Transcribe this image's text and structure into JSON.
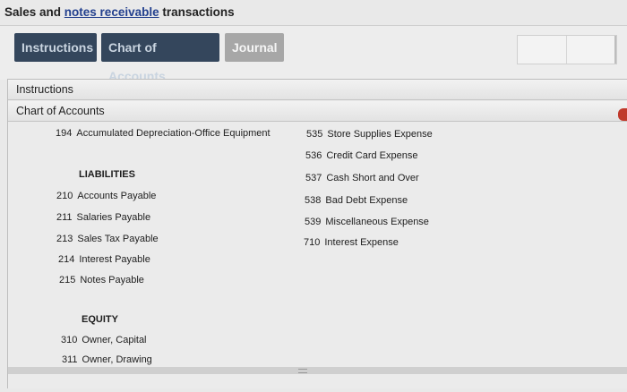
{
  "page": {
    "title_part1": "Sales and ",
    "title_link": "notes receivable",
    "title_part3": " transactions"
  },
  "tabs": [
    {
      "label": "Instructions"
    },
    {
      "label": "Chart of Accounts"
    },
    {
      "label": "Journal"
    }
  ],
  "sections": {
    "instructions_label": "Instructions",
    "chart_label": "Chart of Accounts"
  },
  "accounts": {
    "top": {
      "number": "194",
      "name": "Accumulated Depreciation-Office Equipment"
    },
    "liabilities": {
      "heading": "LIABILITIES",
      "items": [
        {
          "number": "210",
          "name": "Accounts Payable"
        },
        {
          "number": "211",
          "name": "Salaries Payable"
        },
        {
          "number": "213",
          "name": "Sales Tax Payable"
        },
        {
          "number": "214",
          "name": "Interest Payable"
        },
        {
          "number": "215",
          "name": "Notes Payable"
        }
      ]
    },
    "equity": {
      "heading": "EQUITY",
      "items": [
        {
          "number": "310",
          "name": "Owner, Capital"
        },
        {
          "number": "311",
          "name": "Owner, Drawing"
        }
      ]
    },
    "expenses": [
      {
        "number": "535",
        "name": "Store Supplies Expense"
      },
      {
        "number": "536",
        "name": "Credit Card Expense"
      },
      {
        "number": "537",
        "name": "Cash Short and Over"
      },
      {
        "number": "538",
        "name": "Bad Debt Expense"
      },
      {
        "number": "539",
        "name": "Miscellaneous Expense"
      },
      {
        "number": "710",
        "name": "Interest Expense"
      }
    ]
  },
  "colors": {
    "tab_active_dark": "#34465c",
    "tab_inactive": "#a7a7a7",
    "title_link": "#23408e"
  }
}
